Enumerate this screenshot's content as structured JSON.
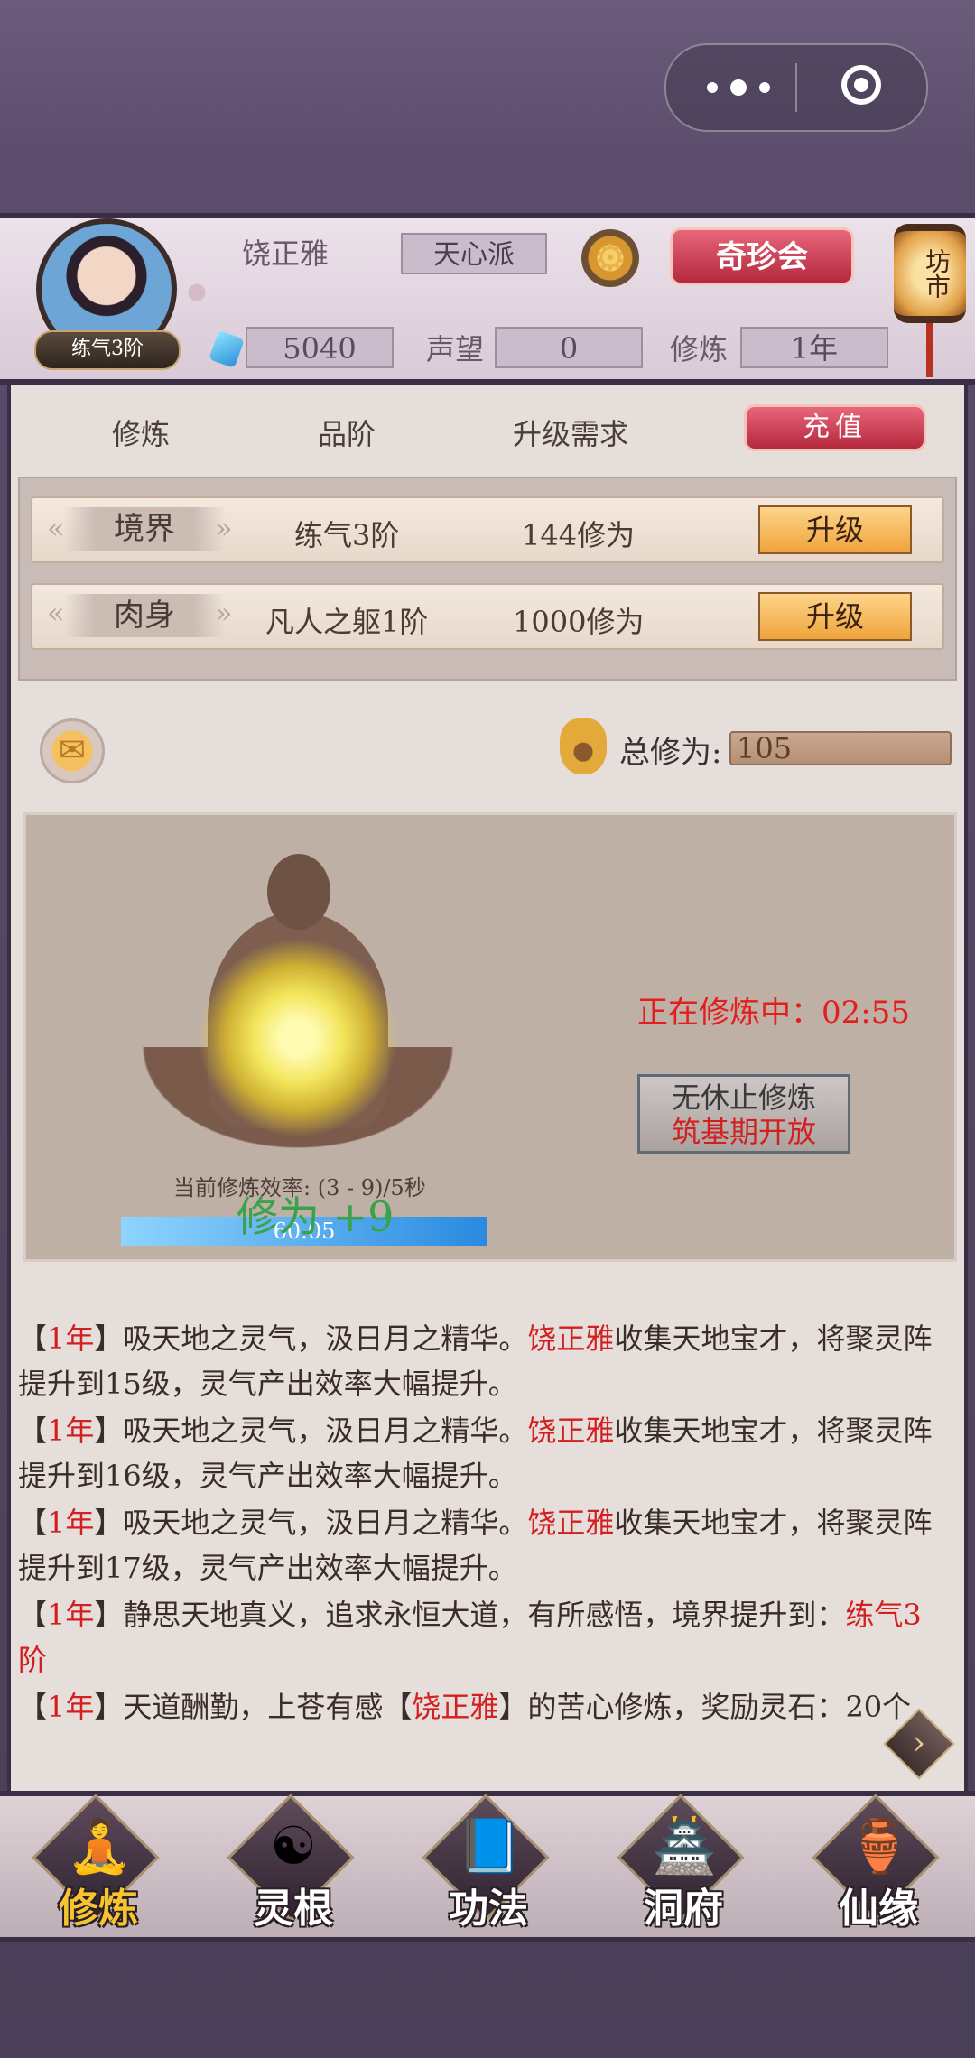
{
  "header": {
    "avatar_badge": "练气3阶",
    "player_name": "饶正雅",
    "sect": "天心派",
    "qizhen_button": "奇珍会",
    "lantern_label": "坊市",
    "spirit_stones": "5040",
    "reputation_label": "声望",
    "reputation_value": "0",
    "cultivation_label": "修炼",
    "cultivation_value": "1年"
  },
  "columns": {
    "col1": "修炼",
    "col2": "品阶",
    "col3": "升级需求",
    "recharge_button": "充值"
  },
  "upgrades": [
    {
      "label": "境界",
      "level": "练气3阶",
      "requirement": "144修为",
      "button": "升级"
    },
    {
      "label": "肉身",
      "level": "凡人之躯1阶",
      "requirement": "1000修为",
      "button": "升级"
    }
  ],
  "totals": {
    "label": "总修为:",
    "value": "105"
  },
  "cultivation": {
    "rate_text": "当前修炼效率: (3 - 9)/5秒",
    "gain_text": "修为 +9",
    "progress_text": "60.05",
    "status_text": "正在修炼中：02:55",
    "endless_line1": "无休止修炼",
    "endless_line2": "筑基期开放"
  },
  "log": [
    {
      "year": "1年",
      "pre": "吸天地之灵气，汲日月之精华。",
      "hl": "饶正雅",
      "post": "收集天地宝才，将聚灵阵提升到15级，灵气产出效率大幅提升。"
    },
    {
      "year": "1年",
      "pre": "吸天地之灵气，汲日月之精华。",
      "hl": "饶正雅",
      "post": "收集天地宝才，将聚灵阵提升到16级，灵气产出效率大幅提升。"
    },
    {
      "year": "1年",
      "pre": "吸天地之灵气，汲日月之精华。",
      "hl": "饶正雅",
      "post": "收集天地宝才，将聚灵阵提升到17级，灵气产出效率大幅提升。"
    },
    {
      "year": "1年",
      "pre": "静思天地真义，追求永恒大道，有所感悟，境界提升到：",
      "hl": "练气3阶",
      "post": ""
    },
    {
      "year": "1年",
      "pre": "天道酬勤，上苍有感【",
      "hl": "饶正雅",
      "post": "】的苦心修炼，奖励灵石：20个"
    }
  ],
  "nav": [
    {
      "label": "修炼",
      "icon": "monk-icon"
    },
    {
      "label": "灵根",
      "icon": "yinyang-icon"
    },
    {
      "label": "功法",
      "icon": "book-icon"
    },
    {
      "label": "洞府",
      "icon": "pagoda-icon"
    },
    {
      "label": "仙缘",
      "icon": "gourd-icon"
    }
  ],
  "colors": {
    "highlight_red": "#d21f1f",
    "frame_dark": "#3a2d45",
    "nav_active": "#f6c431"
  }
}
